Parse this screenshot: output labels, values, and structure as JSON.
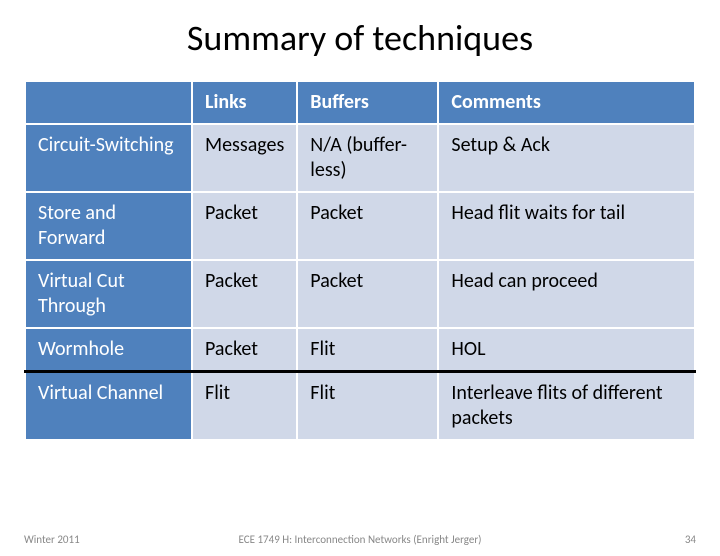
{
  "title": "Summary of techniques",
  "columns": {
    "c0": "",
    "c1": "Links",
    "c2": "Buffers",
    "c3": "Comments"
  },
  "rows": [
    {
      "tech": "Circuit-Switching",
      "links": "Messages",
      "buffers": "N/A (buffer-less)",
      "comments": "Setup & Ack"
    },
    {
      "tech": "Store and Forward",
      "links": "Packet",
      "buffers": "Packet",
      "comments": "Head flit waits for tail"
    },
    {
      "tech": "Virtual Cut Through",
      "links": "Packet",
      "buffers": "Packet",
      "comments": "Head can proceed"
    },
    {
      "tech": "Wormhole",
      "links": "Packet",
      "buffers": "Flit",
      "comments": "HOL"
    },
    {
      "tech": "Virtual Channel",
      "links": "Flit",
      "buffers": "Flit",
      "comments": "Interleave flits of different packets"
    }
  ],
  "footer": {
    "left": "Winter 2011",
    "center": "ECE 1749 H: Interconnection Networks (Enright Jerger)",
    "right": "34"
  }
}
